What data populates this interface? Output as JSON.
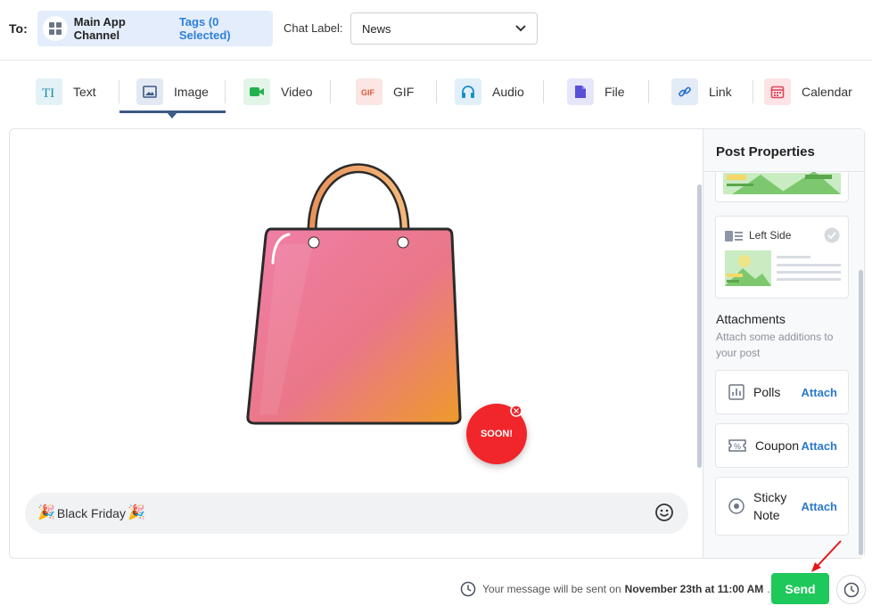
{
  "header": {
    "to_label": "To:",
    "channel_name": "Main App Channel",
    "channel_tags": "Tags (0 Selected)",
    "chat_label": "Chat Label:",
    "chat_label_value": "News"
  },
  "tabs": [
    {
      "label": "Text",
      "icon": "text-icon",
      "active": false
    },
    {
      "label": "Image",
      "icon": "image-icon",
      "active": true
    },
    {
      "label": "Video",
      "icon": "video-icon",
      "active": false
    },
    {
      "label": "GIF",
      "icon": "gif-icon",
      "active": false
    },
    {
      "label": "Audio",
      "icon": "headphones-icon",
      "active": false
    },
    {
      "label": "File",
      "icon": "file-icon",
      "active": false
    },
    {
      "label": "Link",
      "icon": "link-icon",
      "active": false
    },
    {
      "label": "Calendar",
      "icon": "calendar-icon",
      "active": false
    }
  ],
  "post": {
    "badge": "SOON!",
    "caption": "Black Friday"
  },
  "sidebar": {
    "title": "Post Properties",
    "layout_option": "Left Side",
    "attachments_title": "Attachments",
    "attachments_sub": "Attach some additions to your post",
    "items": [
      {
        "label": "Polls",
        "action": "Attach",
        "icon": "chart-icon"
      },
      {
        "label": "Coupon",
        "action": "Attach",
        "icon": "coupon-icon"
      },
      {
        "label": "Sticky Note",
        "action": "Attach",
        "icon": "sticky-note-icon"
      }
    ]
  },
  "footer": {
    "msg_prefix": "Your message will be sent on",
    "msg_date": "November 23th at 11:00 AM",
    "msg_suffix": ".",
    "send_label": "Send"
  },
  "colors": {
    "accent": "#2f80d8",
    "send": "#1ec85a",
    "active_tab": "#3b5a88",
    "badge": "#f0262c"
  }
}
